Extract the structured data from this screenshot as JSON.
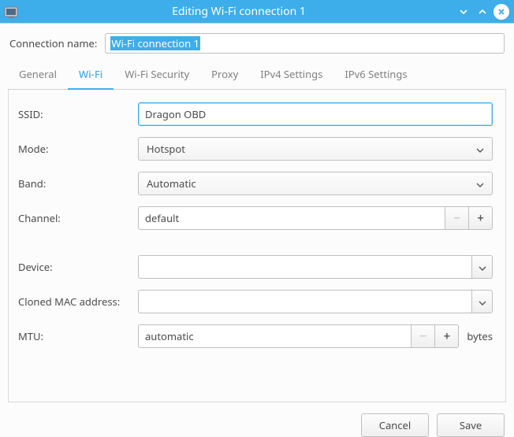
{
  "titlebar": {
    "title": "Editing Wi-Fi connection 1"
  },
  "connection_name": {
    "label": "Connection name:",
    "value": "Wi-Fi connection 1"
  },
  "tabs": [
    {
      "label": "General",
      "active": false
    },
    {
      "label": "Wi-Fi",
      "active": true
    },
    {
      "label": "Wi-Fi Security",
      "active": false
    },
    {
      "label": "Proxy",
      "active": false
    },
    {
      "label": "IPv4 Settings",
      "active": false
    },
    {
      "label": "IPv6 Settings",
      "active": false
    }
  ],
  "form": {
    "ssid": {
      "label": "SSID:",
      "value": "Dragon OBD"
    },
    "mode": {
      "label": "Mode:",
      "value": "Hotspot"
    },
    "band": {
      "label": "Band:",
      "value": "Automatic"
    },
    "channel": {
      "label": "Channel:",
      "value": "default"
    },
    "device": {
      "label": "Device:",
      "value": ""
    },
    "cloned_mac": {
      "label": "Cloned MAC address:",
      "value": ""
    },
    "mtu": {
      "label": "MTU:",
      "value": "automatic",
      "unit": "bytes"
    }
  },
  "footer": {
    "cancel": "Cancel",
    "save": "Save"
  },
  "glyph": {
    "minus": "−",
    "plus": "+"
  }
}
